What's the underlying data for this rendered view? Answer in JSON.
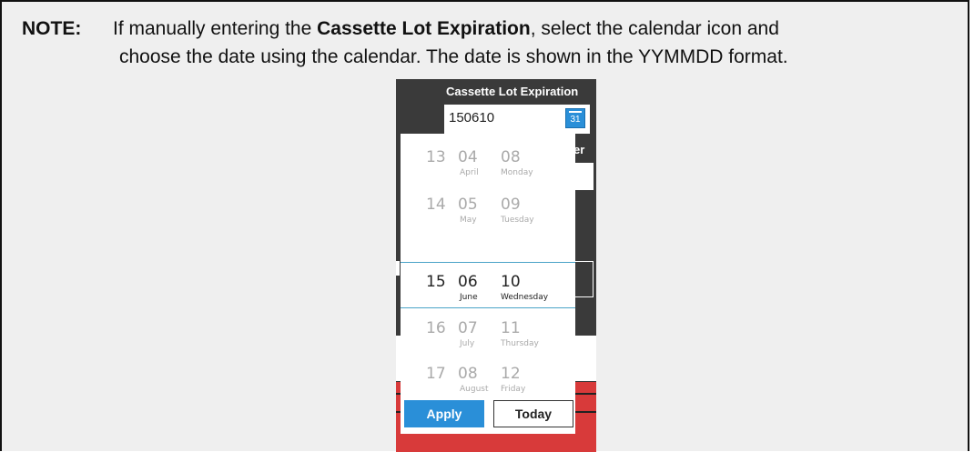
{
  "note": {
    "label": "NOTE:",
    "text_before": "If manually entering the ",
    "bold_term": "Cassette Lot Expiration",
    "text_after": ", select the calendar icon and",
    "line2": "choose the date using the calendar. The date is shown in the YYMMDD format."
  },
  "screenshot": {
    "title": "Cassette Lot Expiration",
    "date_value": "150610",
    "calendar_icon": "calendar-icon",
    "calendar_day": "31",
    "partial_text": "er",
    "rows": [
      {
        "year": "13",
        "month": "04",
        "month_name": "April",
        "day": "08",
        "weekday": "Monday"
      },
      {
        "year": "14",
        "month": "05",
        "month_name": "May",
        "day": "09",
        "weekday": "Tuesday"
      },
      {
        "year": "15",
        "month": "06",
        "month_name": "June",
        "day": "10",
        "weekday": "Wednesday"
      },
      {
        "year": "16",
        "month": "07",
        "month_name": "July",
        "day": "11",
        "weekday": "Thursday"
      },
      {
        "year": "17",
        "month": "08",
        "month_name": "August",
        "day": "12",
        "weekday": "Friday"
      }
    ],
    "selected_index": 2,
    "apply_label": "Apply",
    "today_label": "Today",
    "colors": {
      "accent": "#2a8fd8",
      "selection_line": "#4aa3c8",
      "dark_bg": "#3a3a3a",
      "alert_red": "#d83a3a"
    }
  }
}
